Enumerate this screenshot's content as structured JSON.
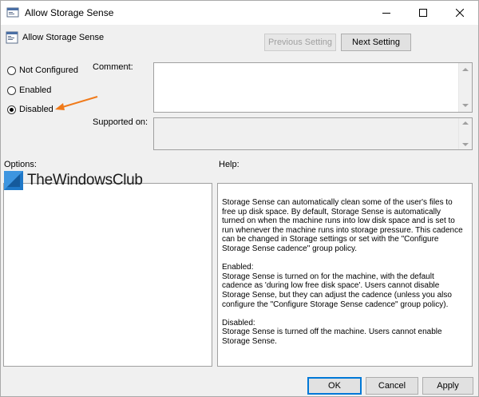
{
  "window": {
    "title": "Allow Storage Sense"
  },
  "header": {
    "policy_name": "Allow Storage Sense"
  },
  "nav": {
    "previous_label": "Previous Setting",
    "next_label": "Next Setting"
  },
  "state_options": [
    {
      "label": "Not Configured",
      "checked": false
    },
    {
      "label": "Enabled",
      "checked": false
    },
    {
      "label": "Disabled",
      "checked": true
    }
  ],
  "comment": {
    "label": "Comment:",
    "value": ""
  },
  "supported": {
    "label": "Supported on:",
    "value": ""
  },
  "options": {
    "label": "Options:"
  },
  "help": {
    "label": "Help:",
    "text": "Storage Sense can automatically clean some of the user's files to free up disk space. By default, Storage Sense is automatically turned on when the machine runs into low disk space and is set to run whenever the machine runs into storage pressure. This cadence can be changed in Storage settings or set with the \"Configure Storage Sense cadence\" group policy.\n\nEnabled:\nStorage Sense is turned on for the machine, with the default cadence as 'during low free disk space'. Users cannot disable Storage Sense, but they can adjust the cadence (unless you also configure the \"Configure Storage Sense cadence\" group policy).\n\nDisabled:\nStorage Sense is turned off the machine. Users cannot enable Storage Sense."
  },
  "watermark": {
    "text": "TheWindowsClub"
  },
  "buttons": {
    "ok": "OK",
    "cancel": "Cancel",
    "apply": "Apply"
  },
  "colors": {
    "annotation_arrow": "#f07a1a",
    "accent": "#0078d7"
  }
}
